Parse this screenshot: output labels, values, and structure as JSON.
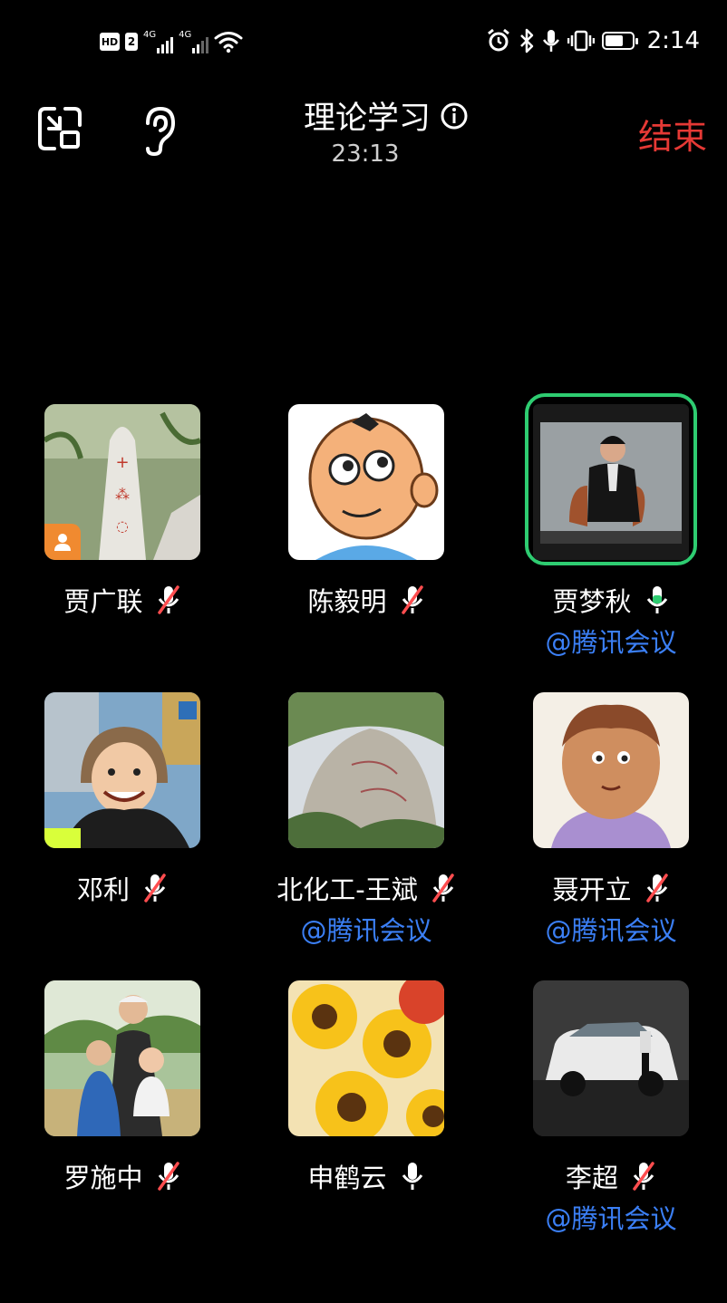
{
  "status_bar": {
    "hd_label": "HD",
    "sim_number": "2",
    "net_label_1": "4G",
    "net_label_2": "4G",
    "time": "2:14",
    "battery_percent": 70
  },
  "header": {
    "title": "理论学习",
    "timer": "23:13",
    "end_label": "结束"
  },
  "participants": [
    {
      "name": "贾广联",
      "mic": "muted",
      "via": "",
      "avatar": "white-tree-photo",
      "host": true,
      "speaking": false
    },
    {
      "name": "陈毅明",
      "mic": "muted",
      "via": "",
      "avatar": "cartoon-boy",
      "host": false,
      "speaking": false
    },
    {
      "name": "贾梦秋",
      "mic": "active",
      "via": "@腾讯会议",
      "avatar": "seated-woman-photo",
      "host": false,
      "speaking": true
    },
    {
      "name": "邓利",
      "mic": "muted",
      "via": "",
      "avatar": "smiling-child-photo",
      "host": false,
      "speaking": false
    },
    {
      "name": "北化工-王斌",
      "mic": "muted",
      "via": "@腾讯会议",
      "avatar": "rock-photo",
      "host": false,
      "speaking": false
    },
    {
      "name": "聂开立",
      "mic": "muted",
      "via": "@腾讯会议",
      "avatar": "cartoon-portrait",
      "host": false,
      "speaking": false
    },
    {
      "name": "罗施中",
      "mic": "muted",
      "via": "",
      "avatar": "family-photo",
      "host": false,
      "speaking": false
    },
    {
      "name": "申鹤云",
      "mic": "on",
      "via": "",
      "avatar": "sunflowers",
      "host": false,
      "speaking": false
    },
    {
      "name": "李超",
      "mic": "muted",
      "via": "@腾讯会议",
      "avatar": "white-car-model",
      "host": false,
      "speaking": false
    }
  ],
  "colors": {
    "end": "#e53935",
    "active_ring": "#2ecc71",
    "via_link": "#3b7ff5",
    "host_badge": "#f08a30",
    "muted_slash": "#ff4d4f"
  }
}
